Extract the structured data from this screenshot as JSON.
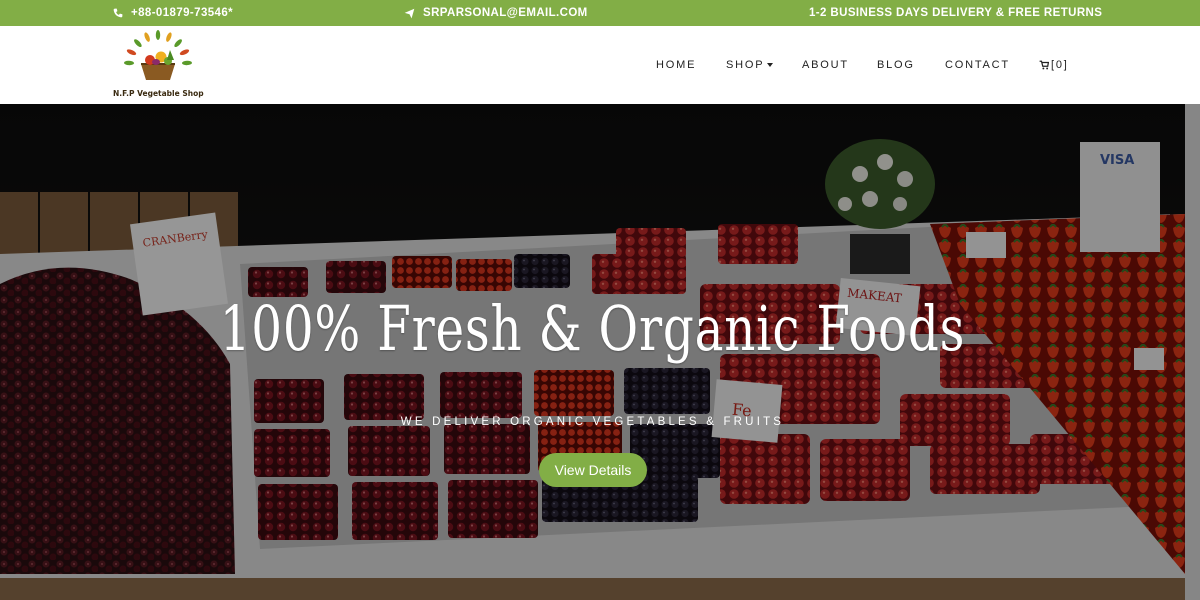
{
  "topbar": {
    "phone": "+88-01879-73546*",
    "email": "SRPARSONAL@EMAIL.COM",
    "shipping": "1-2 BUSINESS DAYS DELIVERY & FREE RETURNS",
    "phone_icon": "phone-icon",
    "email_icon": "paper-plane-icon"
  },
  "brand": {
    "caption": "N.F.P Vegetable Shop"
  },
  "nav": {
    "home": "HOME",
    "shop": "SHOP",
    "about": "ABOUT",
    "blog": "BLOG",
    "contact": "CONTACT",
    "cart_count": "[0]",
    "cart_icon": "cart-icon"
  },
  "hero": {
    "title": "100% Fresh & Organic Foods",
    "subtitle": "WE DELIVER ORGANIC VEGETABLES & FRUITS",
    "button": "View Details",
    "signs": [
      "CRANBerry",
      "VISA",
      "MAKEAT",
      "Fe"
    ]
  },
  "colors": {
    "accent": "#82ae46"
  }
}
